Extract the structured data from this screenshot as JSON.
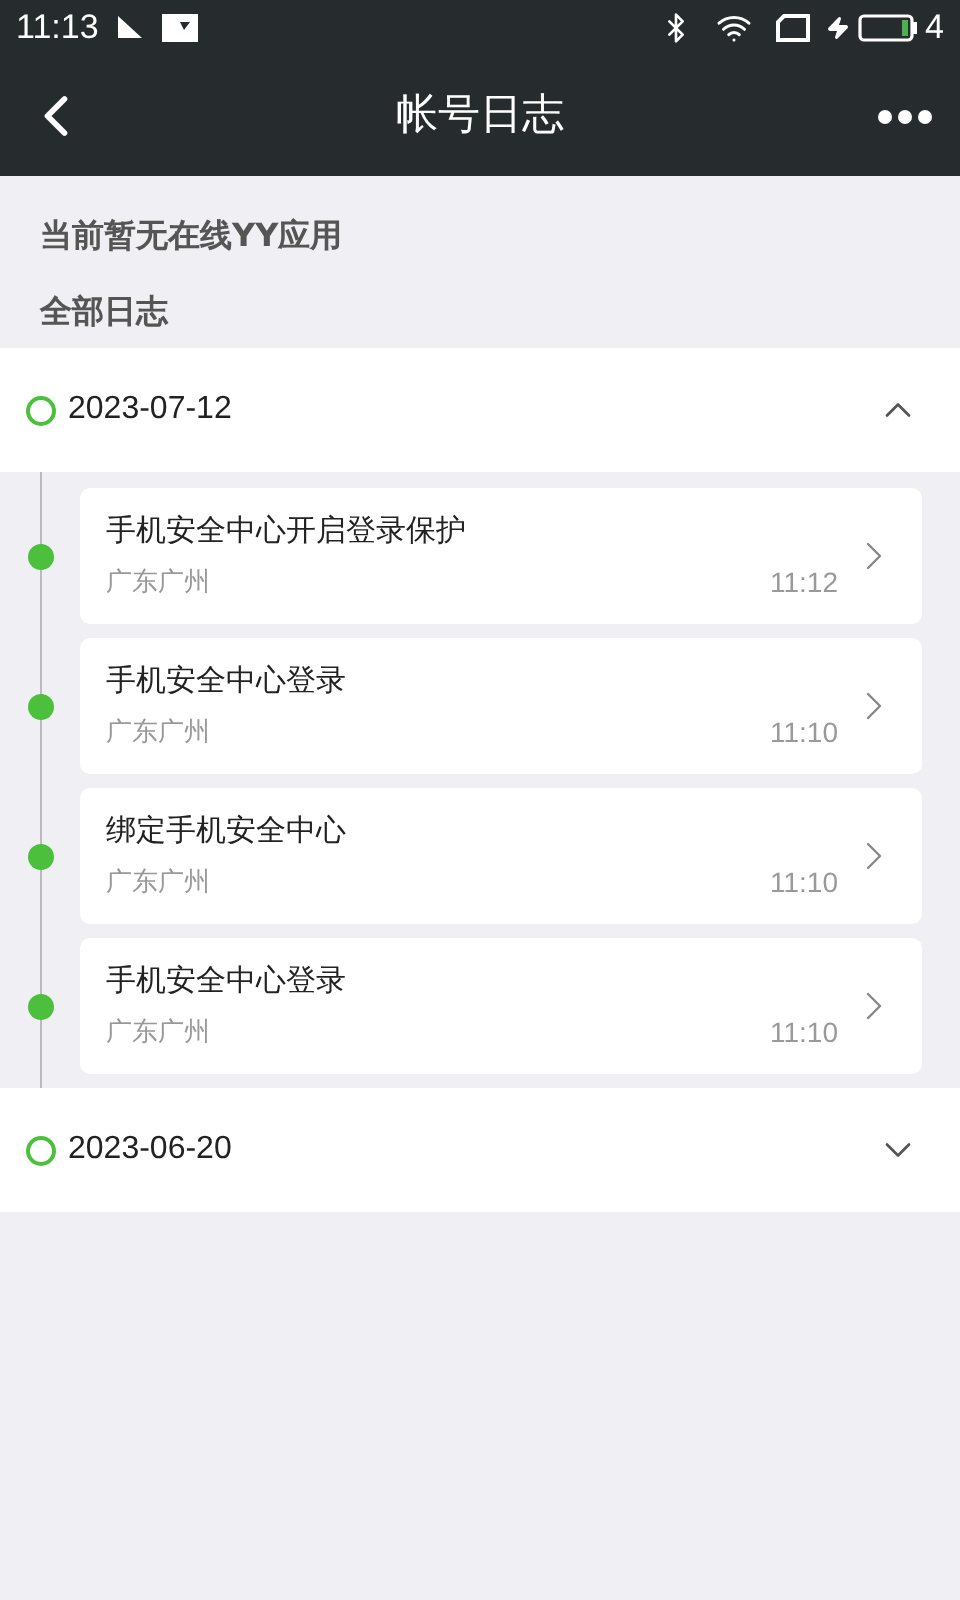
{
  "status_bar": {
    "time": "11:13",
    "battery_text": "4"
  },
  "nav": {
    "title": "帐号日志"
  },
  "online_notice": "当前暂无在线YY应用",
  "section_title": "全部日志",
  "groups": [
    {
      "date": "2023-07-12",
      "expanded": true,
      "entries": [
        {
          "title": "手机安全中心开启登录保护",
          "location": "广东广州",
          "time": "11:12"
        },
        {
          "title": "手机安全中心登录",
          "location": "广东广州",
          "time": "11:10"
        },
        {
          "title": "绑定手机安全中心",
          "location": "广东广州",
          "time": "11:10"
        },
        {
          "title": "手机安全中心登录",
          "location": "广东广州",
          "time": "11:10"
        }
      ]
    },
    {
      "date": "2023-06-20",
      "expanded": false
    }
  ]
}
